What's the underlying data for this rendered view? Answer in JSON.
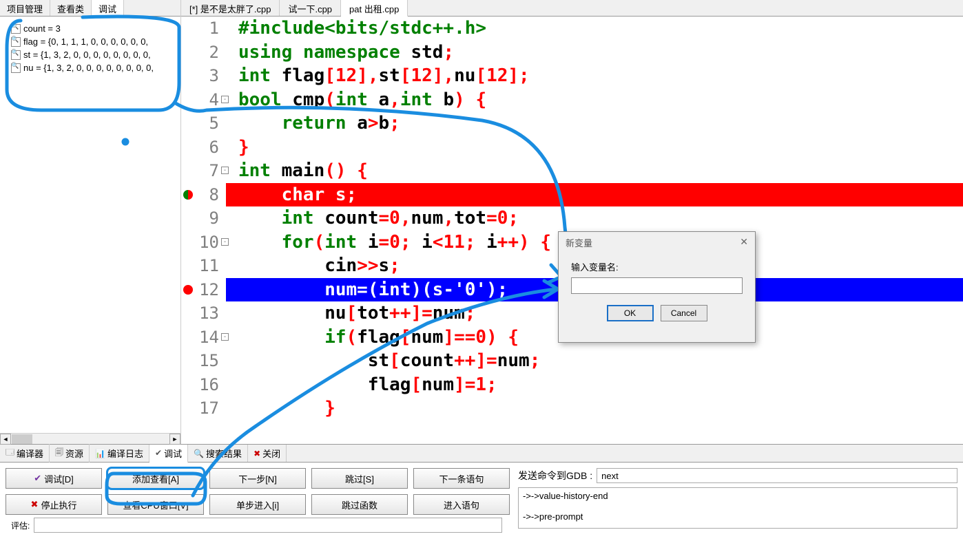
{
  "left_tabs": [
    "项目管理",
    "查看类",
    "调试"
  ],
  "left_active": 2,
  "watches": [
    "count = 3",
    "flag = {0, 1, 1, 1, 0, 0, 0, 0, 0, 0,",
    "st = {1, 3, 2, 0, 0, 0, 0, 0, 0, 0, 0,",
    "nu = {1, 3, 2, 0, 0, 0, 0, 0, 0, 0, 0,"
  ],
  "file_tabs": [
    "[*] 是不是太胖了.cpp",
    "试一下.cpp",
    "pat 出租.cpp"
  ],
  "file_active": 2,
  "code": [
    {
      "n": 1,
      "cls": "",
      "html": "<span class='dir'>#include&lt;bits/stdc++.h&gt;</span>"
    },
    {
      "n": 2,
      "cls": "",
      "html": "<span class='kw'>using</span> <span class='kw'>namespace</span> std<span class='op'>;</span>"
    },
    {
      "n": 3,
      "cls": "",
      "html": "<span class='kw'>int</span> flag<span class='op'>[</span><span class='num'>12</span><span class='op'>],</span>st<span class='op'>[</span><span class='num'>12</span><span class='op'>],</span>nu<span class='op'>[</span><span class='num'>12</span><span class='op'>];</span>"
    },
    {
      "n": 4,
      "cls": "",
      "fold": "-",
      "html": "<span class='kw'>bool</span> cmp<span class='op'>(</span><span class='kw'>int</span> a<span class='op'>,</span><span class='kw'>int</span> b<span class='op'>)</span> <span class='brace'>{</span>"
    },
    {
      "n": 5,
      "cls": "",
      "html": "    <span class='kw'>return</span> a<span class='op'>&gt;</span>b<span class='op'>;</span>"
    },
    {
      "n": 6,
      "cls": "",
      "html": "<span class='brace'>}</span>"
    },
    {
      "n": 7,
      "cls": "",
      "fold": "-",
      "html": "<span class='kw'>int</span> main<span class='op'>()</span> <span class='brace'>{</span>"
    },
    {
      "n": 8,
      "cls": "red-bg",
      "bp": true,
      "html": "    char s;"
    },
    {
      "n": 9,
      "cls": "",
      "html": "    <span class='kw'>int</span> count<span class='op'>=</span><span class='num'>0</span><span class='op'>,</span>num<span class='op'>,</span>tot<span class='op'>=</span><span class='num'>0</span><span class='op'>;</span>"
    },
    {
      "n": 10,
      "cls": "",
      "fold": "-",
      "html": "    <span class='kw'>for</span><span class='op'>(</span><span class='kw'>int</span> i<span class='op'>=</span><span class='num'>0</span><span class='op'>;</span> i<span class='op'>&lt;</span><span class='num'>11</span><span class='op'>;</span> i<span class='op'>++)</span> <span class='brace'>{</span>"
    },
    {
      "n": 11,
      "cls": "",
      "html": "        cin<span class='op'>&gt;&gt;</span>s<span class='op'>;</span>"
    },
    {
      "n": 12,
      "cls": "blue-bg",
      "bp": true,
      "html": "        num=(int)(s-'0');"
    },
    {
      "n": 13,
      "cls": "",
      "html": "        nu<span class='op'>[</span>tot<span class='op'>++]=</span>num<span class='op'>;</span>"
    },
    {
      "n": 14,
      "cls": "",
      "fold": "-",
      "html": "        <span class='kw'>if</span><span class='op'>(</span>flag<span class='op'>[</span>num<span class='op'>]==</span><span class='num'>0</span><span class='op'>)</span> <span class='brace'>{</span>"
    },
    {
      "n": 15,
      "cls": "",
      "html": "            st<span class='op'>[</span>count<span class='op'>++]=</span>num<span class='op'>;</span>"
    },
    {
      "n": 16,
      "cls": "",
      "html": "            flag<span class='op'>[</span>num<span class='op'>]=</span><span class='num'>1</span><span class='op'>;</span>"
    },
    {
      "n": 17,
      "cls": "",
      "html": "        <span class='brace'>}</span>"
    }
  ],
  "dialog": {
    "title": "新变量",
    "label": "输入变量名:",
    "ok": "OK",
    "cancel": "Cancel"
  },
  "bottom_tabs": [
    {
      "icon": "🗔",
      "label": "编译器"
    },
    {
      "icon": "🗐",
      "label": "资源"
    },
    {
      "icon": "📊",
      "label": "编译日志"
    },
    {
      "icon": "✔",
      "label": "调试",
      "active": true
    },
    {
      "icon": "🔍",
      "label": "搜索结果"
    },
    {
      "icon": "✖",
      "label": "关闭",
      "iconcolor": "#c00"
    }
  ],
  "debug_buttons": [
    {
      "icon": "✔",
      "label": "调试[D]",
      "iconcolor": "#7030a0"
    },
    {
      "label": "添加查看[A]",
      "hl": true
    },
    {
      "label": "下一步[N]"
    },
    {
      "label": "跳过[S]"
    },
    {
      "label": "下一条语句"
    },
    {
      "icon": "✖",
      "label": "停止执行",
      "iconcolor": "#c00"
    },
    {
      "label": "查看CPU窗口[V]"
    },
    {
      "label": "单步进入[i]"
    },
    {
      "label": "跳过函数"
    },
    {
      "label": "进入语句"
    }
  ],
  "gdb": {
    "label": "发送命令到GDB :",
    "cmd": "next",
    "out": [
      "->->value-history-end",
      "",
      "->->pre-prompt"
    ]
  },
  "eval_label": "评估:",
  "watermark": ""
}
